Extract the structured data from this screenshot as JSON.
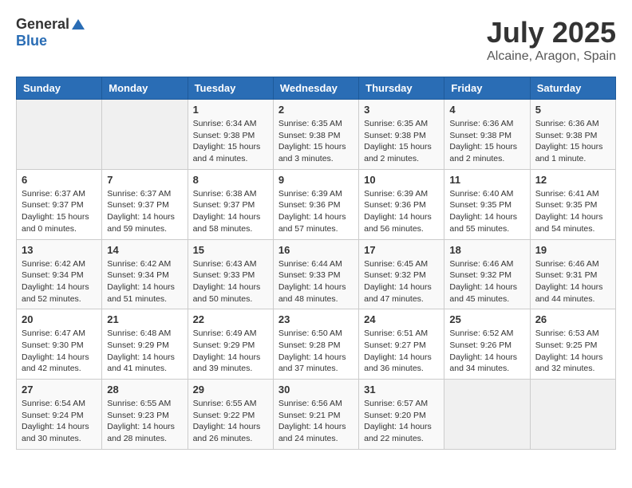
{
  "logo": {
    "text_general": "General",
    "text_blue": "Blue"
  },
  "header": {
    "month": "July 2025",
    "location": "Alcaine, Aragon, Spain"
  },
  "weekdays": [
    "Sunday",
    "Monday",
    "Tuesday",
    "Wednesday",
    "Thursday",
    "Friday",
    "Saturday"
  ],
  "weeks": [
    [
      {
        "day": "",
        "info": ""
      },
      {
        "day": "",
        "info": ""
      },
      {
        "day": "1",
        "sunrise": "Sunrise: 6:34 AM",
        "sunset": "Sunset: 9:38 PM",
        "daylight": "Daylight: 15 hours and 4 minutes."
      },
      {
        "day": "2",
        "sunrise": "Sunrise: 6:35 AM",
        "sunset": "Sunset: 9:38 PM",
        "daylight": "Daylight: 15 hours and 3 minutes."
      },
      {
        "day": "3",
        "sunrise": "Sunrise: 6:35 AM",
        "sunset": "Sunset: 9:38 PM",
        "daylight": "Daylight: 15 hours and 2 minutes."
      },
      {
        "day": "4",
        "sunrise": "Sunrise: 6:36 AM",
        "sunset": "Sunset: 9:38 PM",
        "daylight": "Daylight: 15 hours and 2 minutes."
      },
      {
        "day": "5",
        "sunrise": "Sunrise: 6:36 AM",
        "sunset": "Sunset: 9:38 PM",
        "daylight": "Daylight: 15 hours and 1 minute."
      }
    ],
    [
      {
        "day": "6",
        "sunrise": "Sunrise: 6:37 AM",
        "sunset": "Sunset: 9:37 PM",
        "daylight": "Daylight: 15 hours and 0 minutes."
      },
      {
        "day": "7",
        "sunrise": "Sunrise: 6:37 AM",
        "sunset": "Sunset: 9:37 PM",
        "daylight": "Daylight: 14 hours and 59 minutes."
      },
      {
        "day": "8",
        "sunrise": "Sunrise: 6:38 AM",
        "sunset": "Sunset: 9:37 PM",
        "daylight": "Daylight: 14 hours and 58 minutes."
      },
      {
        "day": "9",
        "sunrise": "Sunrise: 6:39 AM",
        "sunset": "Sunset: 9:36 PM",
        "daylight": "Daylight: 14 hours and 57 minutes."
      },
      {
        "day": "10",
        "sunrise": "Sunrise: 6:39 AM",
        "sunset": "Sunset: 9:36 PM",
        "daylight": "Daylight: 14 hours and 56 minutes."
      },
      {
        "day": "11",
        "sunrise": "Sunrise: 6:40 AM",
        "sunset": "Sunset: 9:35 PM",
        "daylight": "Daylight: 14 hours and 55 minutes."
      },
      {
        "day": "12",
        "sunrise": "Sunrise: 6:41 AM",
        "sunset": "Sunset: 9:35 PM",
        "daylight": "Daylight: 14 hours and 54 minutes."
      }
    ],
    [
      {
        "day": "13",
        "sunrise": "Sunrise: 6:42 AM",
        "sunset": "Sunset: 9:34 PM",
        "daylight": "Daylight: 14 hours and 52 minutes."
      },
      {
        "day": "14",
        "sunrise": "Sunrise: 6:42 AM",
        "sunset": "Sunset: 9:34 PM",
        "daylight": "Daylight: 14 hours and 51 minutes."
      },
      {
        "day": "15",
        "sunrise": "Sunrise: 6:43 AM",
        "sunset": "Sunset: 9:33 PM",
        "daylight": "Daylight: 14 hours and 50 minutes."
      },
      {
        "day": "16",
        "sunrise": "Sunrise: 6:44 AM",
        "sunset": "Sunset: 9:33 PM",
        "daylight": "Daylight: 14 hours and 48 minutes."
      },
      {
        "day": "17",
        "sunrise": "Sunrise: 6:45 AM",
        "sunset": "Sunset: 9:32 PM",
        "daylight": "Daylight: 14 hours and 47 minutes."
      },
      {
        "day": "18",
        "sunrise": "Sunrise: 6:46 AM",
        "sunset": "Sunset: 9:32 PM",
        "daylight": "Daylight: 14 hours and 45 minutes."
      },
      {
        "day": "19",
        "sunrise": "Sunrise: 6:46 AM",
        "sunset": "Sunset: 9:31 PM",
        "daylight": "Daylight: 14 hours and 44 minutes."
      }
    ],
    [
      {
        "day": "20",
        "sunrise": "Sunrise: 6:47 AM",
        "sunset": "Sunset: 9:30 PM",
        "daylight": "Daylight: 14 hours and 42 minutes."
      },
      {
        "day": "21",
        "sunrise": "Sunrise: 6:48 AM",
        "sunset": "Sunset: 9:29 PM",
        "daylight": "Daylight: 14 hours and 41 minutes."
      },
      {
        "day": "22",
        "sunrise": "Sunrise: 6:49 AM",
        "sunset": "Sunset: 9:29 PM",
        "daylight": "Daylight: 14 hours and 39 minutes."
      },
      {
        "day": "23",
        "sunrise": "Sunrise: 6:50 AM",
        "sunset": "Sunset: 9:28 PM",
        "daylight": "Daylight: 14 hours and 37 minutes."
      },
      {
        "day": "24",
        "sunrise": "Sunrise: 6:51 AM",
        "sunset": "Sunset: 9:27 PM",
        "daylight": "Daylight: 14 hours and 36 minutes."
      },
      {
        "day": "25",
        "sunrise": "Sunrise: 6:52 AM",
        "sunset": "Sunset: 9:26 PM",
        "daylight": "Daylight: 14 hours and 34 minutes."
      },
      {
        "day": "26",
        "sunrise": "Sunrise: 6:53 AM",
        "sunset": "Sunset: 9:25 PM",
        "daylight": "Daylight: 14 hours and 32 minutes."
      }
    ],
    [
      {
        "day": "27",
        "sunrise": "Sunrise: 6:54 AM",
        "sunset": "Sunset: 9:24 PM",
        "daylight": "Daylight: 14 hours and 30 minutes."
      },
      {
        "day": "28",
        "sunrise": "Sunrise: 6:55 AM",
        "sunset": "Sunset: 9:23 PM",
        "daylight": "Daylight: 14 hours and 28 minutes."
      },
      {
        "day": "29",
        "sunrise": "Sunrise: 6:55 AM",
        "sunset": "Sunset: 9:22 PM",
        "daylight": "Daylight: 14 hours and 26 minutes."
      },
      {
        "day": "30",
        "sunrise": "Sunrise: 6:56 AM",
        "sunset": "Sunset: 9:21 PM",
        "daylight": "Daylight: 14 hours and 24 minutes."
      },
      {
        "day": "31",
        "sunrise": "Sunrise: 6:57 AM",
        "sunset": "Sunset: 9:20 PM",
        "daylight": "Daylight: 14 hours and 22 minutes."
      },
      {
        "day": "",
        "info": ""
      },
      {
        "day": "",
        "info": ""
      }
    ]
  ]
}
